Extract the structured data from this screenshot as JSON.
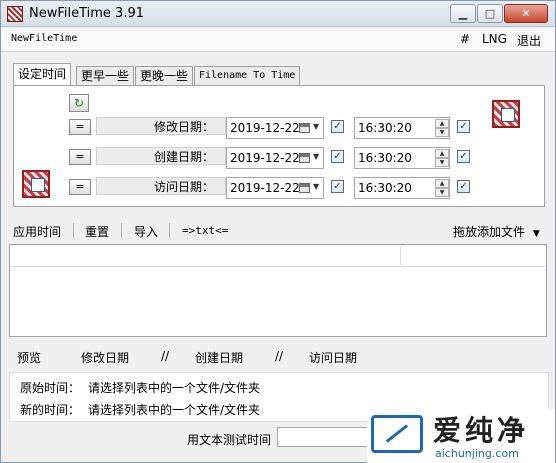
{
  "window": {
    "title": "NewFileTime 3.91"
  },
  "menu": {
    "app_name": "NewFileTime",
    "hash": "#",
    "lng": "LNG",
    "exit": "退出"
  },
  "tabs": [
    {
      "label": "设定时间"
    },
    {
      "label": "更早一些"
    },
    {
      "label": "更晚一些"
    },
    {
      "label": "Filename To Time"
    }
  ],
  "rows": [
    {
      "eq": "=",
      "label": "修改日期：",
      "date": "2019-12-22",
      "time": "16:30:20"
    },
    {
      "eq": "=",
      "label": "创建日期：",
      "date": "2019-12-22",
      "time": "16:30:20"
    },
    {
      "eq": "=",
      "label": "访问日期：",
      "date": "2019-12-22",
      "time": "16:30:20"
    }
  ],
  "toolbar": {
    "apply": "应用时间",
    "reset": "重置",
    "import": "导入",
    "txt": "=>txt<=",
    "drag_add": "拖放添加文件"
  },
  "preview": {
    "label": "预览",
    "modify": "修改日期",
    "sep": "//",
    "create": "创建日期",
    "access": "访问日期"
  },
  "info": {
    "original_label": "原始时间：",
    "original_value": "请选择列表中的一个文件/文件夹",
    "new_label": "新的时间：",
    "new_value": "请选择列表中的一个文件/文件夹"
  },
  "test": {
    "label": "用文本测试时间",
    "value": ""
  },
  "watermark": {
    "text": "爱纯净",
    "url": "aichunjing.com"
  },
  "colors": {
    "check_mark": "#1b3a7a",
    "brand_icon": "#b52a2a",
    "watermark_blue": "#1e67b3"
  }
}
